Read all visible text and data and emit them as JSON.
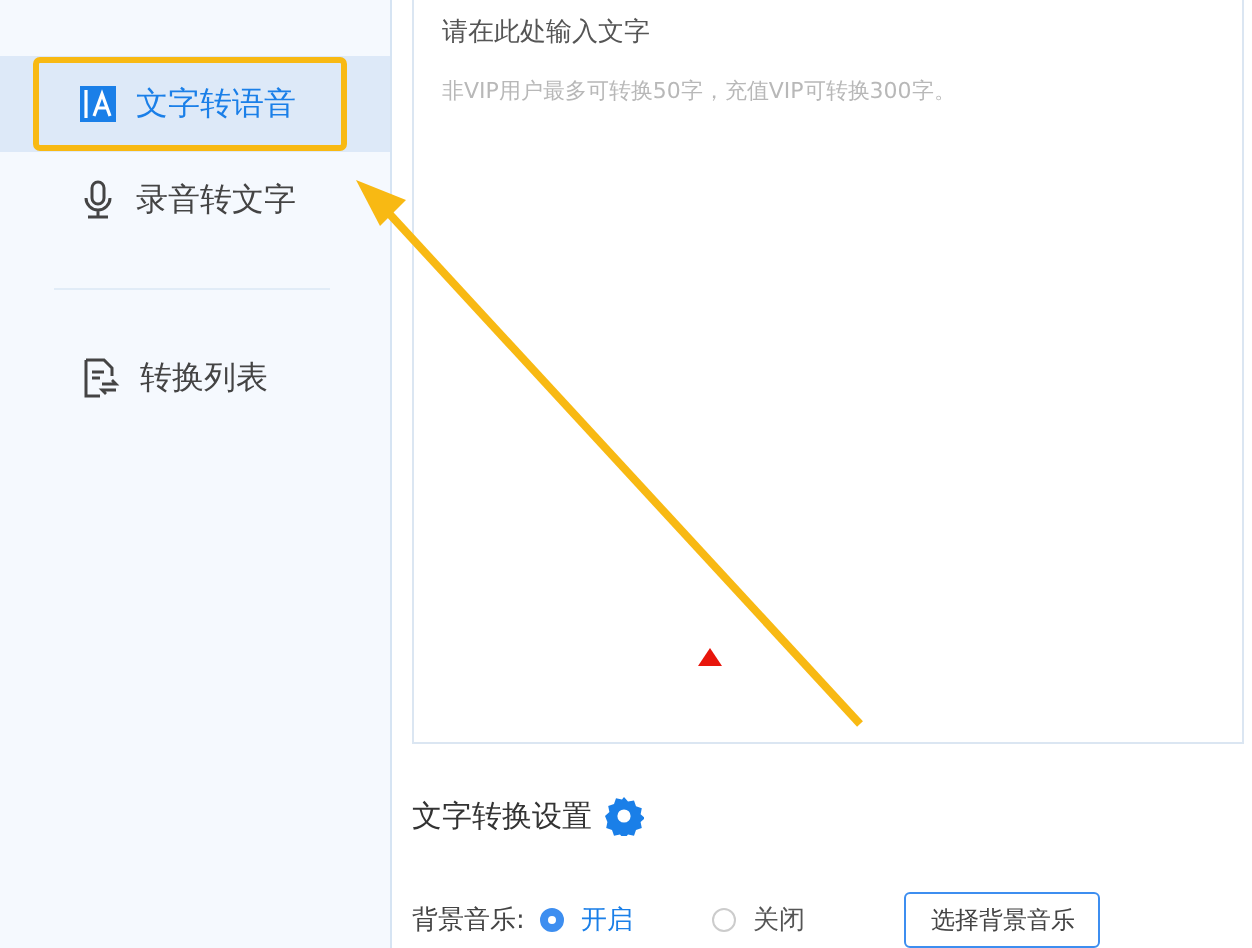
{
  "sidebar": {
    "items": [
      {
        "label": "文字转语音",
        "kind": "text",
        "selected": true
      },
      {
        "label": "录音转文字",
        "kind": "mic",
        "selected": false
      },
      {
        "label": "转换列表",
        "kind": "list",
        "selected": false
      }
    ]
  },
  "editor": {
    "placeholder": "请在此处输入文字",
    "hint": "非VIP用户最多可转换50字，充值VIP可转换300字。"
  },
  "settings": {
    "title": "文字转换设置",
    "background_music": {
      "label": "背景音乐:",
      "options": [
        {
          "label": "开启",
          "selected": true
        },
        {
          "label": "关闭",
          "selected": false
        }
      ],
      "button": "选择背景音乐"
    }
  }
}
